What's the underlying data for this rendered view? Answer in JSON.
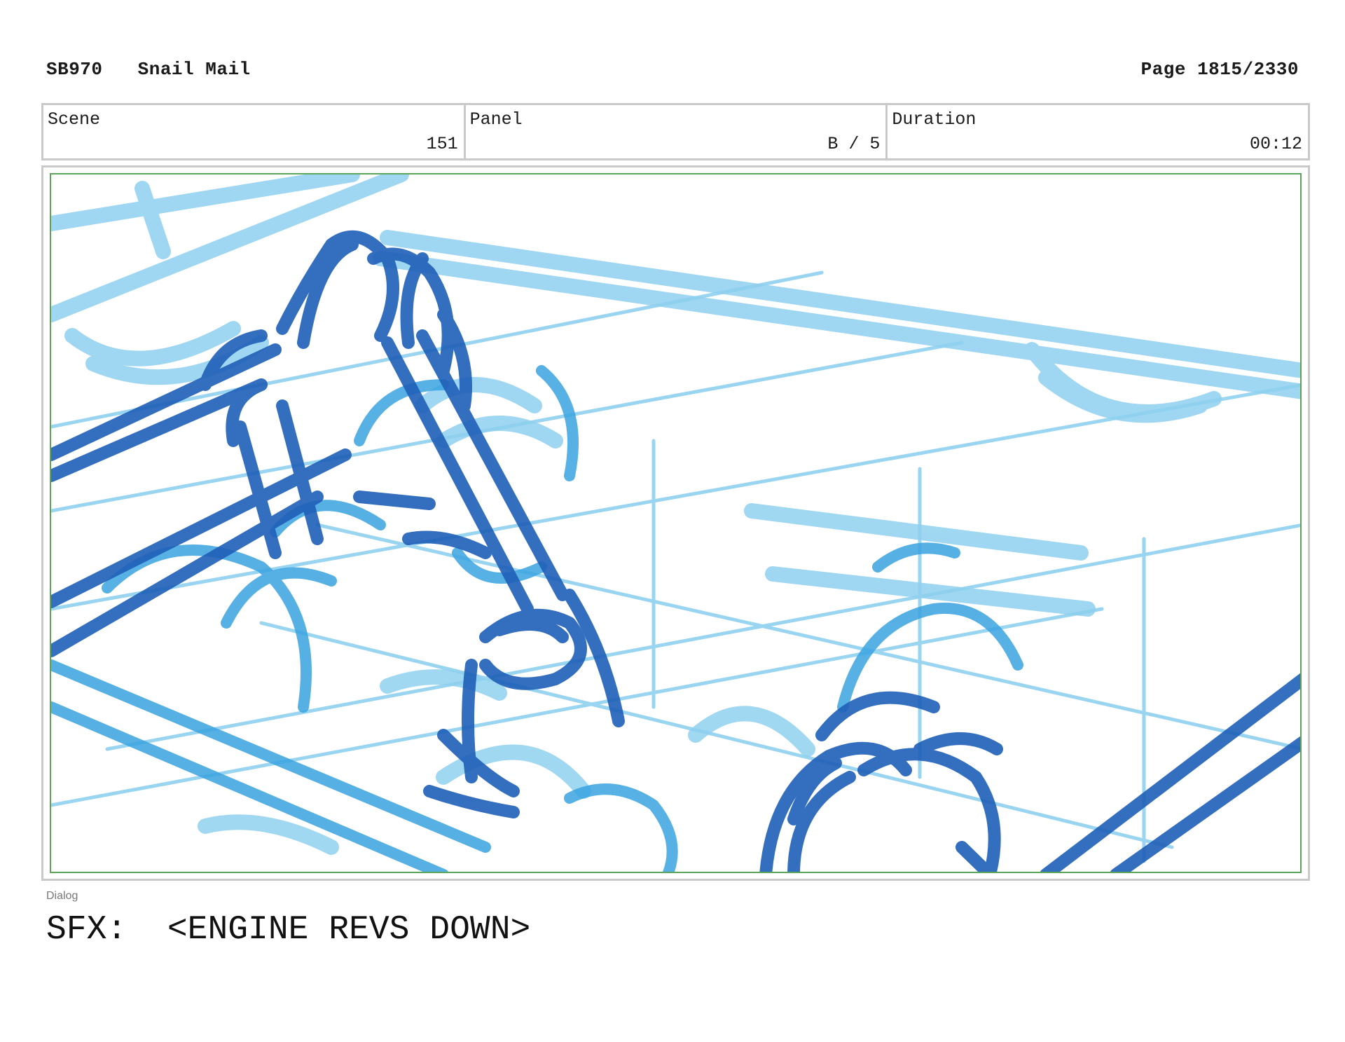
{
  "header": {
    "code": "SB970",
    "title": "Snail Mail",
    "page": "Page 1815/2330"
  },
  "info": {
    "scene_label": "Scene",
    "scene_value": "151",
    "panel_label": "Panel",
    "panel_value": "B / 5",
    "duration_label": "Duration",
    "duration_value": "00:12"
  },
  "panel": {
    "stroke_colors": {
      "dark": "#1f5fb8",
      "medium": "#3aa3e0",
      "light": "#8fd0ef",
      "border": "#5aa55a"
    }
  },
  "dialog": {
    "label": "Dialog",
    "text": "SFX:  <ENGINE REVS DOWN>"
  }
}
